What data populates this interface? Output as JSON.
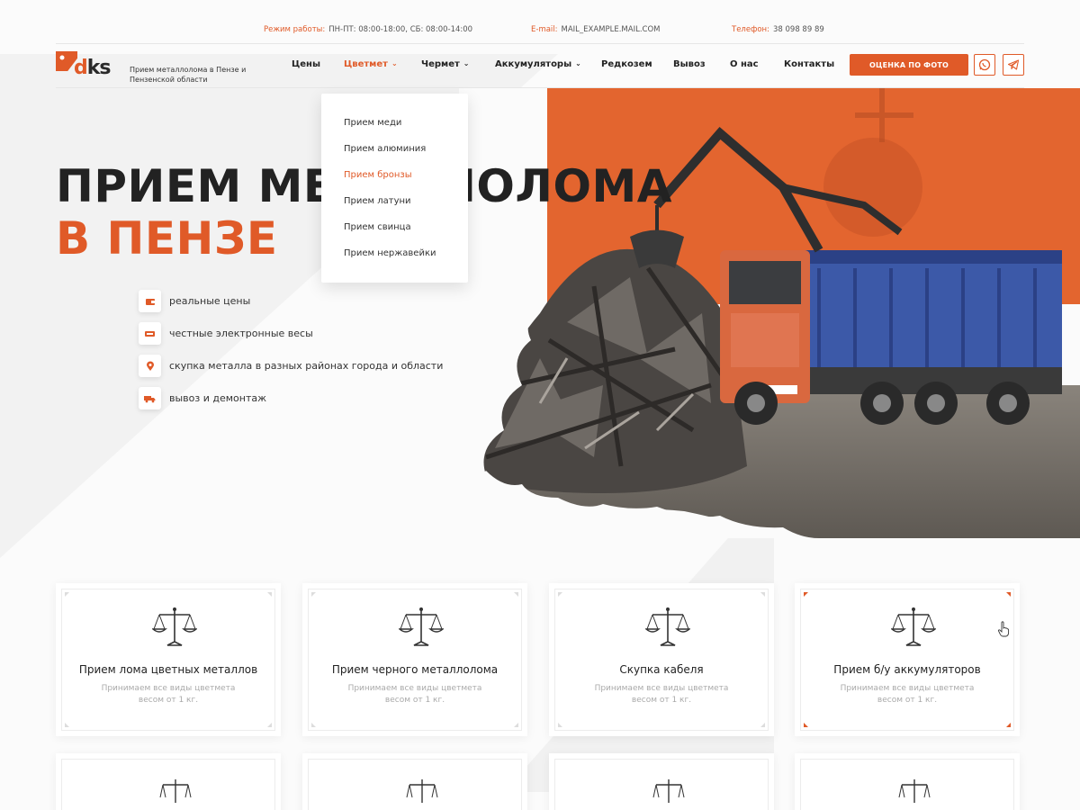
{
  "info_bar": {
    "hours_label": "Режим работы:",
    "hours_value": "ПН-ПТ: 08:00-18:00,  СБ: 08:00-14:00",
    "email_label": "E-mail:",
    "email_value": "MAIL_EXAMPLE.MAIL.COM",
    "phone_label": "Телефон:",
    "phone_value": "38 098 89 89"
  },
  "header": {
    "logo_text_d": "d",
    "logo_text_ks": "ks",
    "tagline": "Прием металлолома в Пензе и Пензенской области",
    "nav": [
      {
        "label": "Цены",
        "has_dropdown": false
      },
      {
        "label": "Цветмет",
        "has_dropdown": true,
        "active": true
      },
      {
        "label": "Чермет",
        "has_dropdown": true
      },
      {
        "label": "Аккумуляторы",
        "has_dropdown": true
      },
      {
        "label": "Редкозем",
        "has_dropdown": false
      },
      {
        "label": "Вывоз",
        "has_dropdown": false
      },
      {
        "label": "О нас",
        "has_dropdown": false
      },
      {
        "label": "Контакты",
        "has_dropdown": false
      }
    ],
    "cta_label": "ОЦЕНКА ПО ФОТО",
    "icons": [
      "whatsapp-icon",
      "telegram-icon"
    ]
  },
  "dropdown": {
    "items": [
      {
        "label": "Прием меди"
      },
      {
        "label": "Прием алюминия"
      },
      {
        "label": "Прием бронзы",
        "active": true
      },
      {
        "label": "Прием латуни"
      },
      {
        "label": "Прием свинца"
      },
      {
        "label": "Прием нержавейки"
      }
    ]
  },
  "hero": {
    "title_line1": "ПРИЕМ МЕТАЛЛОЛОМА",
    "title_line2": "В ПЕНЗЕ",
    "features": [
      {
        "icon": "wallet-icon",
        "text": "реальные цены"
      },
      {
        "icon": "scales-icon",
        "text": "честные электронные весы"
      },
      {
        "icon": "location-pin-icon",
        "text": "скупка металла в разных районах города и области"
      },
      {
        "icon": "truck-icon",
        "text": "вывоз и демонтаж"
      }
    ]
  },
  "services": [
    {
      "title": "Прием лома цветных металлов",
      "desc": "Принимаем все виды цветмета весом от 1 кг."
    },
    {
      "title": "Прием черного металлолома",
      "desc": "Принимаем все виды цветмета весом от 1 кг."
    },
    {
      "title": "Скупка кабеля",
      "desc": "Принимаем все виды цветмета весом от 1 кг."
    },
    {
      "title": "Прием б/у аккумуляторов",
      "desc": "Принимаем все виды цветмета весом от 1 кг.",
      "hovered": true
    }
  ],
  "colors": {
    "accent": "#e05a28",
    "text_dark": "#222222",
    "text_muted": "#aaaaaa"
  }
}
